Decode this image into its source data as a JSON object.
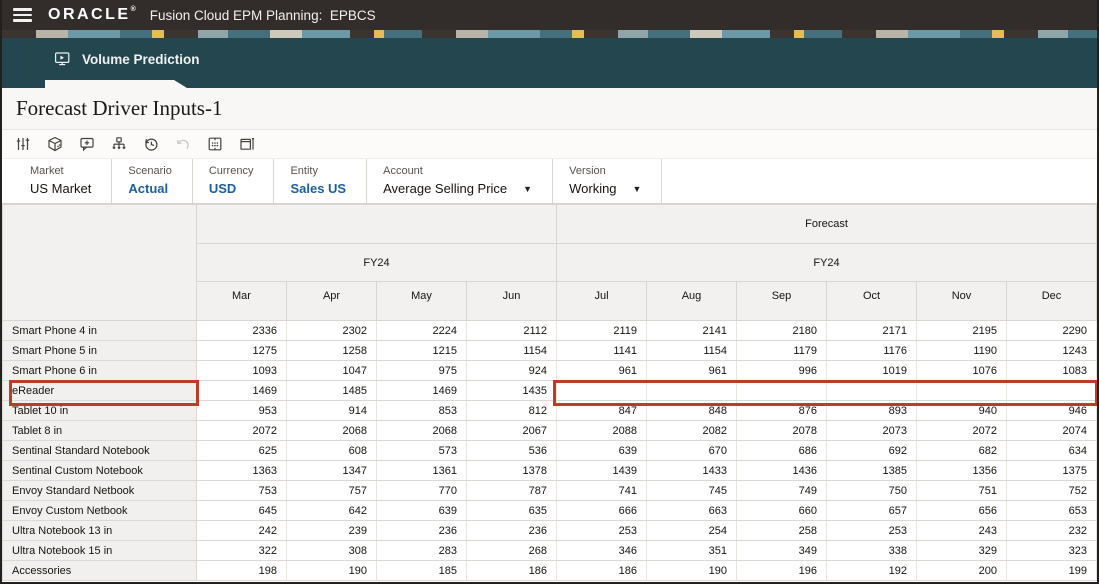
{
  "topbar": {
    "brand": "ORACLE",
    "brand_mark": "®",
    "app_title": "Fusion Cloud EPM Planning:  EPBCS"
  },
  "banner": {
    "tab_label": "Volume Prediction"
  },
  "page": {
    "title": "Forecast Driver Inputs-1"
  },
  "toolbar": {
    "icons": [
      "adjust-sliders-icon",
      "cube-icon",
      "comment-add-icon",
      "hierarchy-icon",
      "history-icon",
      "undo-icon",
      "grid-icon",
      "panel-width-icon"
    ],
    "undo_disabled": true
  },
  "pov": {
    "items": [
      {
        "label": "Market",
        "value": "US Market",
        "style": "plain",
        "dropdown": false
      },
      {
        "label": "Scenario",
        "value": "Actual",
        "style": "link",
        "dropdown": false
      },
      {
        "label": "Currency",
        "value": "USD",
        "style": "link",
        "dropdown": false
      },
      {
        "label": "Entity",
        "value": "Sales US",
        "style": "link",
        "dropdown": false
      },
      {
        "label": "Account",
        "value": "Average Selling Price",
        "style": "plain",
        "dropdown": true
      },
      {
        "label": "Version",
        "value": "Working",
        "style": "plain",
        "dropdown": true
      }
    ],
    "caret": "▼"
  },
  "grid": {
    "forecast_label": "Forecast",
    "fy_left": "FY24",
    "fy_right": "FY24",
    "months": [
      "Mar",
      "Apr",
      "May",
      "Jun",
      "Jul",
      "Aug",
      "Sep",
      "Oct",
      "Nov",
      "Dec"
    ],
    "rows": [
      {
        "label": "Smart Phone 4 in",
        "values": [
          "2336",
          "2302",
          "2224",
          "2112",
          "2119",
          "2141",
          "2180",
          "2171",
          "2195",
          "2290"
        ]
      },
      {
        "label": "Smart Phone 5 in",
        "values": [
          "1275",
          "1258",
          "1215",
          "1154",
          "1141",
          "1154",
          "1179",
          "1176",
          "1190",
          "1243"
        ]
      },
      {
        "label": "Smart Phone 6 in",
        "values": [
          "1093",
          "1047",
          "975",
          "924",
          "961",
          "961",
          "996",
          "1019",
          "1076",
          "1083"
        ]
      },
      {
        "label": "eReader",
        "values": [
          "1469",
          "1485",
          "1469",
          "1435",
          "",
          "",
          "",
          "",
          "",
          ""
        ]
      },
      {
        "label": "Tablet 10 in",
        "values": [
          "953",
          "914",
          "853",
          "812",
          "847",
          "848",
          "876",
          "893",
          "940",
          "946"
        ]
      },
      {
        "label": "Tablet 8 in",
        "values": [
          "2072",
          "2068",
          "2068",
          "2067",
          "2088",
          "2082",
          "2078",
          "2073",
          "2072",
          "2074"
        ]
      },
      {
        "label": "Sentinal Standard Notebook",
        "values": [
          "625",
          "608",
          "573",
          "536",
          "639",
          "670",
          "686",
          "692",
          "682",
          "634"
        ]
      },
      {
        "label": "Sentinal Custom Notebook",
        "values": [
          "1363",
          "1347",
          "1361",
          "1378",
          "1439",
          "1433",
          "1436",
          "1385",
          "1356",
          "1375"
        ]
      },
      {
        "label": "Envoy Standard Netbook",
        "values": [
          "753",
          "757",
          "770",
          "787",
          "741",
          "745",
          "749",
          "750",
          "751",
          "752"
        ]
      },
      {
        "label": "Envoy Custom Netbook",
        "values": [
          "645",
          "642",
          "639",
          "635",
          "666",
          "663",
          "660",
          "657",
          "656",
          "653"
        ]
      },
      {
        "label": "Ultra Notebook 13 in",
        "values": [
          "242",
          "239",
          "236",
          "236",
          "253",
          "254",
          "258",
          "253",
          "243",
          "232"
        ]
      },
      {
        "label": "Ultra Notebook 15 in",
        "values": [
          "322",
          "308",
          "283",
          "268",
          "346",
          "351",
          "349",
          "338",
          "329",
          "323"
        ]
      },
      {
        "label": "Accessories",
        "values": [
          "198",
          "190",
          "185",
          "186",
          "186",
          "190",
          "196",
          "192",
          "200",
          "199"
        ]
      }
    ],
    "highlight": {
      "row": "eReader",
      "color": "#bc3c26"
    }
  },
  "colors": {
    "topbar_bg": "#322d2a",
    "banner_bg": "#24464f",
    "link_blue": "#1b5f9e",
    "highlight_red": "#bc3c26",
    "header_bg": "#f3f1ef"
  }
}
